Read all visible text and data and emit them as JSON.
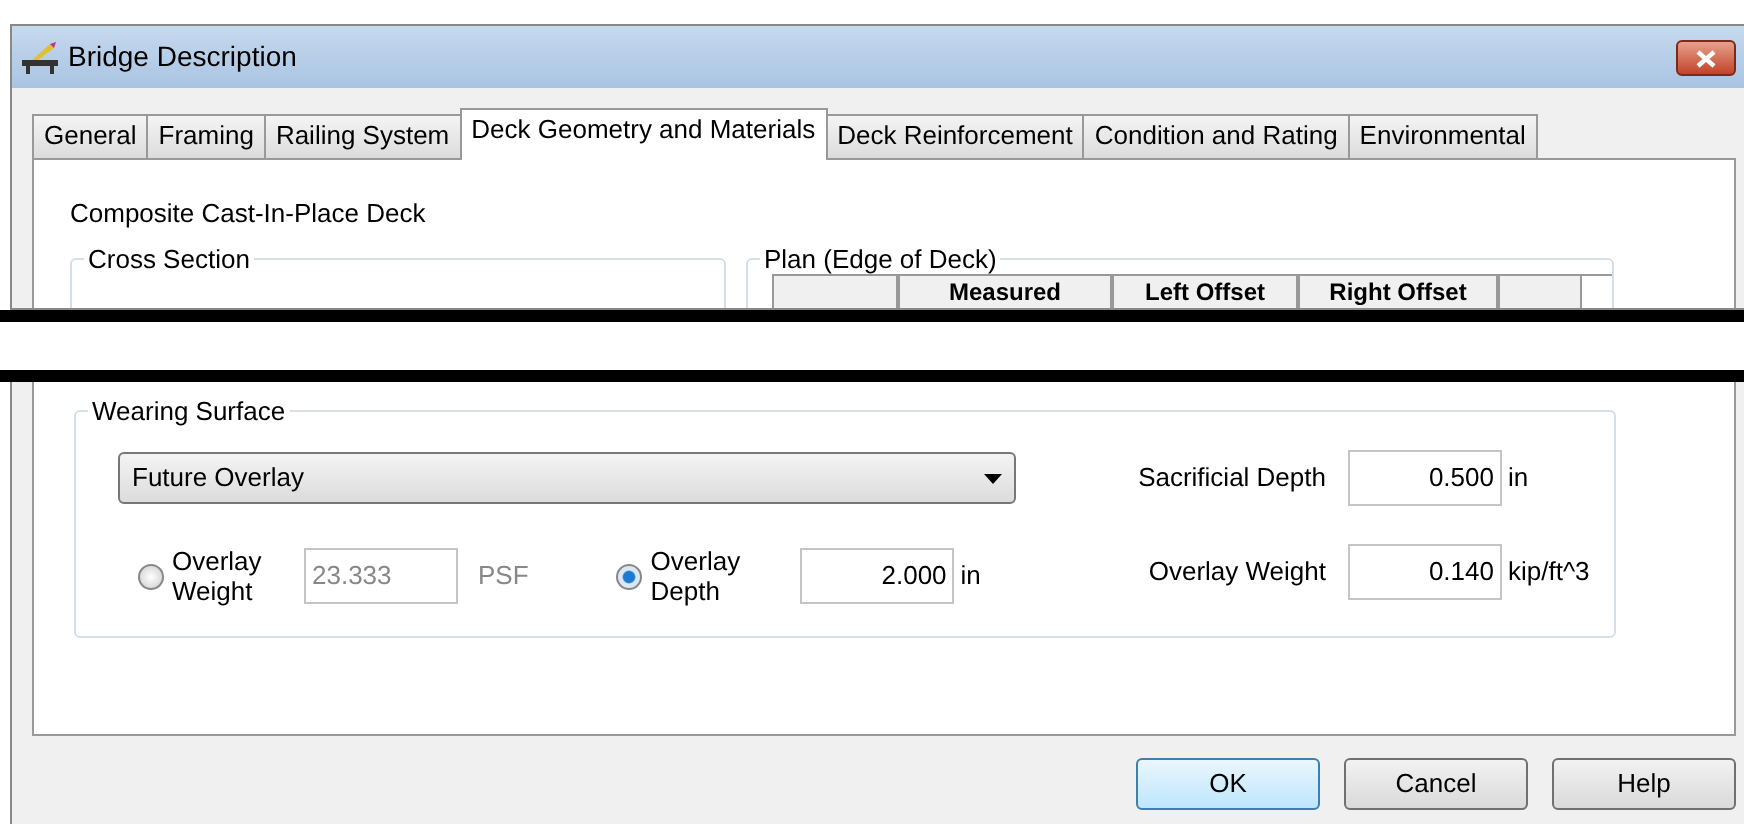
{
  "window": {
    "title": "Bridge Description"
  },
  "tabs": [
    {
      "label": "General",
      "selected": false
    },
    {
      "label": "Framing",
      "selected": false
    },
    {
      "label": "Railing System",
      "selected": false
    },
    {
      "label": "Deck Geometry and Materials",
      "selected": true
    },
    {
      "label": "Deck Reinforcement",
      "selected": false
    },
    {
      "label": "Condition and Rating",
      "selected": false
    },
    {
      "label": "Environmental",
      "selected": false
    }
  ],
  "deck_type": "Composite Cast-In-Place Deck",
  "cross_section": {
    "title": "Cross Section"
  },
  "plan": {
    "title": "Plan (Edge of Deck)",
    "columns": [
      "Measured",
      "Left Offset",
      "Right Offset"
    ]
  },
  "wearing_surface": {
    "title": "Wearing Surface",
    "type": "Future Overlay",
    "options": [
      {
        "label": "Overlay Weight",
        "selected": false,
        "value": "23.333",
        "unit": "PSF",
        "disabled": true
      },
      {
        "label": "Overlay Depth",
        "selected": true,
        "value": "2.000",
        "unit": "in",
        "disabled": false
      }
    ],
    "fields": [
      {
        "label": "Sacrificial Depth",
        "value": "0.500",
        "unit": "in"
      },
      {
        "label": "Overlay Weight",
        "value": "0.140",
        "unit": "kip/ft^3"
      }
    ]
  },
  "buttons": [
    {
      "label": "OK",
      "default": true
    },
    {
      "label": "Cancel",
      "default": false
    },
    {
      "label": "Help",
      "default": false
    }
  ]
}
